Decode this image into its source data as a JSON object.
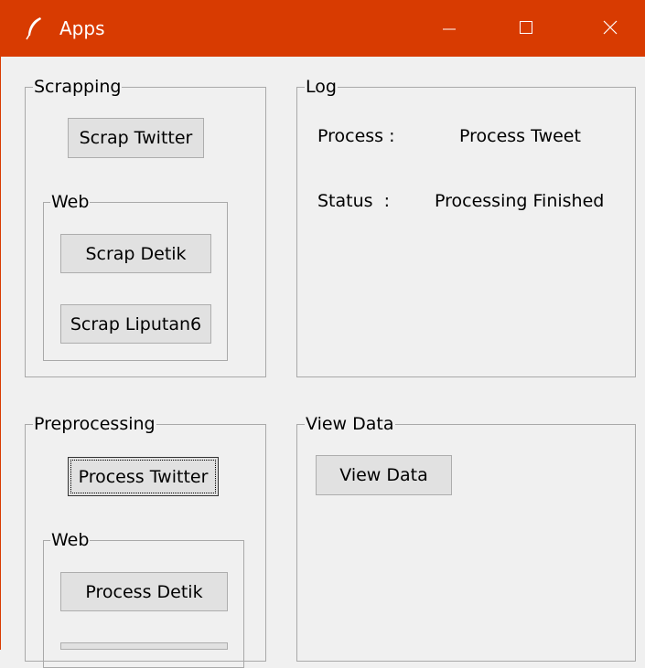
{
  "window": {
    "title": "Apps",
    "accent_color": "#d83b01",
    "app_icon": "feather-icon",
    "controls": [
      "minimize-icon",
      "maximize-icon",
      "close-icon"
    ]
  },
  "scrapping": {
    "legend": "Scrapping",
    "twitter_button": "Scrap Twitter",
    "web": {
      "legend": "Web",
      "detik_button": "Scrap Detik",
      "liputan6_button": "Scrap Liputan6"
    }
  },
  "log": {
    "legend": "Log",
    "process_label": "Process :",
    "process_value": "Process Tweet",
    "status_label": "Status  :",
    "status_value": "Processing Finished"
  },
  "preprocessing": {
    "legend": "Preprocessing",
    "twitter_button": "Process Twitter",
    "web": {
      "legend": "Web",
      "detik_button": "Process Detik",
      "liputan6_button": ""
    }
  },
  "view_data": {
    "legend": "View Data",
    "button": "View Data"
  }
}
